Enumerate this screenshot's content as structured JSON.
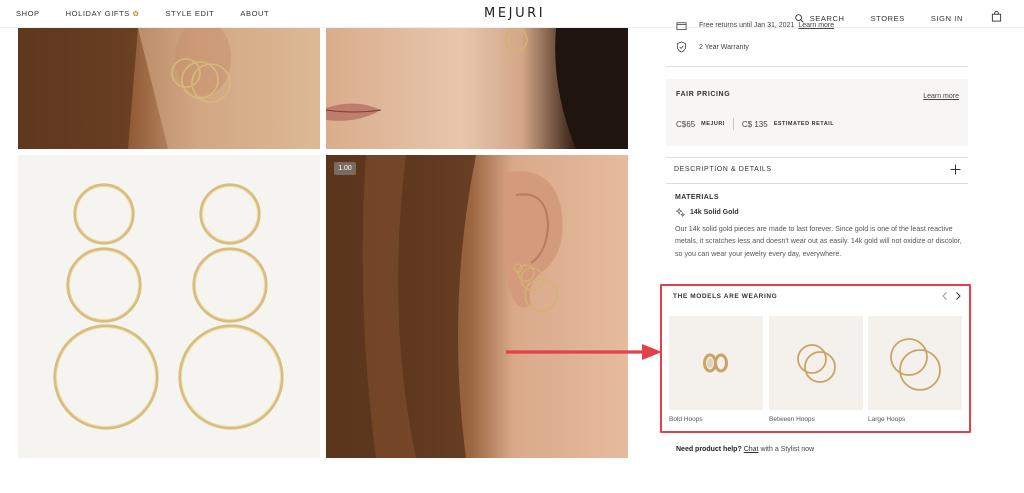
{
  "header": {
    "nav_left": [
      "SHOP",
      "HOLIDAY GIFTS",
      "STYLE EDIT",
      "ABOUT"
    ],
    "logo": "MEJURI",
    "search": "SEARCH",
    "stores": "STORES",
    "sign_in": "SIGN IN"
  },
  "gallery": {
    "zoom_level": "1.00"
  },
  "perks": {
    "returns": "Free returns until Jan 31, 2021",
    "returns_link": "Learn more",
    "warranty": "2 Year Warranty"
  },
  "pricing": {
    "title": "FAIR PRICING",
    "learn_more": "Learn more",
    "mejuri_price": "C$65",
    "mejuri_tag": "MEJURI",
    "retail_price": "C$ 135",
    "retail_tag": "ESTIMATED RETAIL"
  },
  "details": {
    "heading": "DESCRIPTION & DETAILS",
    "materials_label": "MATERIALS",
    "material": "14k Solid Gold",
    "description": "Our 14k solid gold pieces are made to last forever. Since gold is one of the least reactive metals, it scratches less and doesn't wear out as easily. 14k gold will not oxidize or discolor, so you can wear your jewelry every day, everywhere."
  },
  "models": {
    "title": "THE MODELS ARE WEARING",
    "items": [
      {
        "label": "Bold Hoops"
      },
      {
        "label": "Between Hoops"
      },
      {
        "label": "Large Hoops"
      }
    ]
  },
  "help": {
    "prompt": "Need product help?",
    "chat": "Chat",
    "suffix": "with a Stylist now"
  },
  "colors": {
    "highlight": "#e2404a",
    "gold": "#c9a464"
  }
}
